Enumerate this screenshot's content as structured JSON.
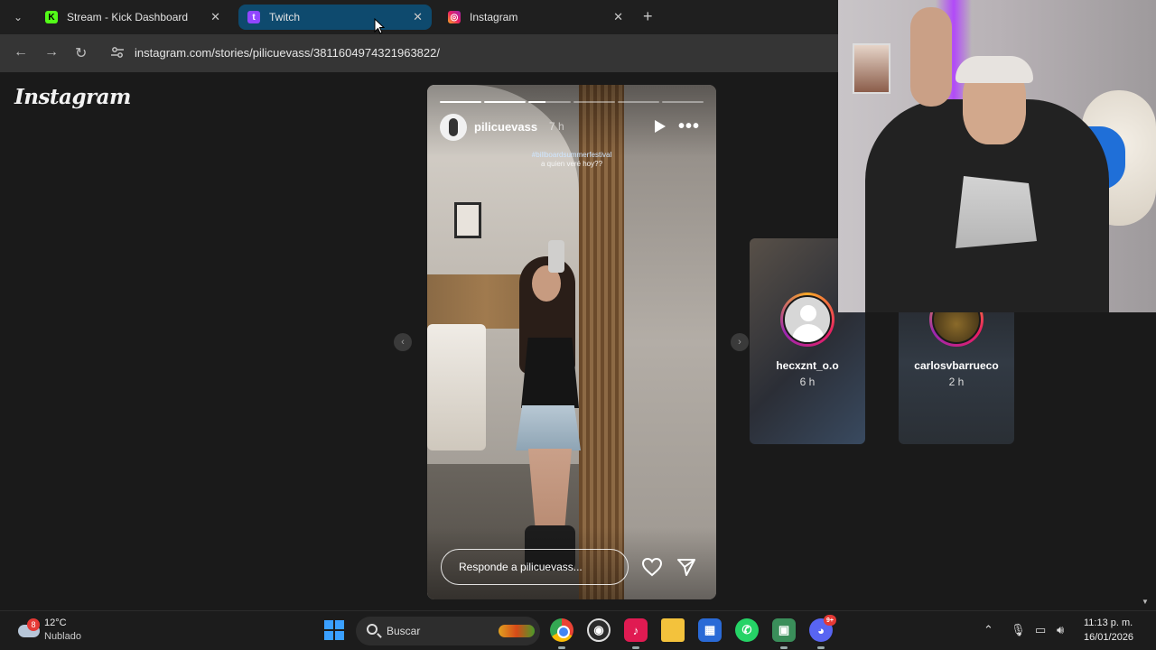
{
  "browser": {
    "tabs": [
      {
        "label": "Stream - Kick Dashboard",
        "icon": "kick-icon",
        "color": "#53fc18"
      },
      {
        "label": "Twitch",
        "icon": "twitch-icon",
        "color": "#9146ff"
      },
      {
        "label": "Instagram",
        "icon": "instagram-icon",
        "color": "#e1306c"
      }
    ],
    "url": "instagram.com/stories/pilicuevass/3811604974321963822/"
  },
  "instagram": {
    "logo": "Instagram",
    "story": {
      "username": "pilicuevass",
      "time": "7 h",
      "caption_tag": "#billboardsummerfestival",
      "caption_text": "a quien veré hoy??",
      "reply_placeholder": "Responde a pilicuevass...",
      "progress": [
        1,
        1,
        0.4,
        0,
        0,
        0
      ]
    },
    "up_next": [
      {
        "username": "heсxznt_o.o",
        "time": "6 h"
      },
      {
        "username": "carlosvbarrueco",
        "time": "2 h"
      }
    ]
  },
  "taskbar": {
    "weather_badge": "8",
    "temperature": "12°C",
    "condition": "Nublado",
    "search_placeholder": "Buscar",
    "discord_badge": "9+",
    "time": "11:13 p. m.",
    "date": "16/01/2026"
  }
}
